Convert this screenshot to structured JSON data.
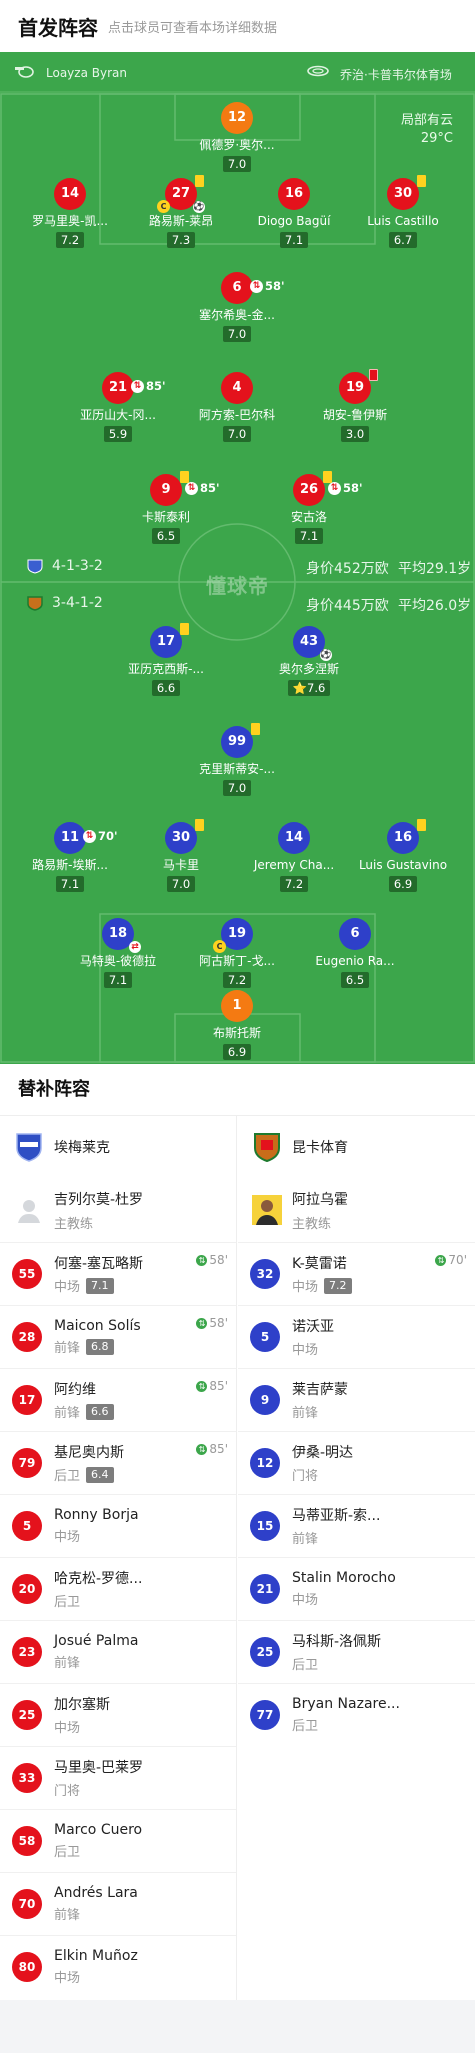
{
  "header": {
    "title": "首发阵容",
    "subtitle": "点击球员可查看本场详细数据"
  },
  "pitch": {
    "home_team": "Loayza Byran",
    "stadium": "乔治·卡普韦尔体育场",
    "weather": "局部有云",
    "temperature": "29°C",
    "home_formation": "4-1-3-2",
    "home_value": "身价452万欧",
    "home_age": "平均29.1岁",
    "away_formation": "3-4-1-2",
    "away_value": "身价445万欧",
    "away_age": "平均26.0岁",
    "watermark": "懂球帝",
    "colors": {
      "pitch": "#3ca64b",
      "home": "#e4121c",
      "away": "#2e40c9",
      "keeper_home": "#f47a12",
      "yellow_card": "#ffd21f"
    }
  },
  "home_players": [
    {
      "num": "12",
      "name": "佩德罗·奥尔...",
      "rating": "7.0"
    },
    {
      "num": "14",
      "name": "罗马里奥-凯...",
      "rating": "7.2"
    },
    {
      "num": "27",
      "name": "路易斯-莱昂",
      "rating": "7.3"
    },
    {
      "num": "16",
      "name": "Diogo Bagüí",
      "rating": "7.1"
    },
    {
      "num": "30",
      "name": "Luis Castillo",
      "rating": "6.7"
    },
    {
      "num": "6",
      "name": "塞尔希奥-金...",
      "rating": "7.0",
      "sub_min": "58'"
    },
    {
      "num": "21",
      "name": "亚历山大-冈...",
      "rating": "5.9",
      "sub_min": "85'"
    },
    {
      "num": "4",
      "name": "阿方索-巴尔科",
      "rating": "7.0"
    },
    {
      "num": "19",
      "name": "胡安-鲁伊斯",
      "rating": "3.0"
    },
    {
      "num": "9",
      "name": "卡斯泰利",
      "rating": "6.5",
      "sub_min": "85'"
    },
    {
      "num": "26",
      "name": "安古洛",
      "rating": "7.1",
      "sub_min": "58'"
    }
  ],
  "away_players": [
    {
      "num": "17",
      "name": "亚历克西斯-...",
      "rating": "6.6"
    },
    {
      "num": "43",
      "name": "奥尔多涅斯",
      "rating": "7.6",
      "star": "⭐"
    },
    {
      "num": "99",
      "name": "克里斯蒂安-...",
      "rating": "7.0"
    },
    {
      "num": "11",
      "name": "路易斯-埃斯...",
      "rating": "7.1",
      "sub_min": "70'"
    },
    {
      "num": "30",
      "name": "马卡里",
      "rating": "7.0"
    },
    {
      "num": "14",
      "name": "Jeremy Cha...",
      "rating": "7.2"
    },
    {
      "num": "16",
      "name": "Luis Gustavino",
      "rating": "6.9"
    },
    {
      "num": "18",
      "name": "马特奥-彼德拉",
      "rating": "7.1"
    },
    {
      "num": "19",
      "name": "阿古斯丁-戈...",
      "rating": "7.2"
    },
    {
      "num": "6",
      "name": "Eugenio Ra...",
      "rating": "6.5"
    },
    {
      "num": "1",
      "name": "布斯托斯",
      "rating": "6.9"
    }
  ],
  "subs": {
    "title": "替补阵容",
    "home": {
      "team": "埃梅莱克",
      "coach": "吉列尔莫-杜罗",
      "coach_role": "主教练",
      "players": [
        {
          "num": "55",
          "name": "何塞-塞瓦略斯",
          "pos": "中场",
          "rating": "7.1",
          "time": "58'"
        },
        {
          "num": "28",
          "name": "Maicon Solís",
          "pos": "前锋",
          "rating": "6.8",
          "time": "58'"
        },
        {
          "num": "17",
          "name": "阿约维",
          "pos": "前锋",
          "rating": "6.6",
          "time": "85'"
        },
        {
          "num": "79",
          "name": "基尼奥内斯",
          "pos": "后卫",
          "rating": "6.4",
          "time": "85'"
        },
        {
          "num": "5",
          "name": "Ronny Borja",
          "pos": "中场"
        },
        {
          "num": "20",
          "name": "哈克松-罗德...",
          "pos": "后卫"
        },
        {
          "num": "23",
          "name": "Josué Palma",
          "pos": "前锋"
        },
        {
          "num": "25",
          "name": "加尔塞斯",
          "pos": "中场"
        },
        {
          "num": "33",
          "name": "马里奥-巴莱罗",
          "pos": "门将"
        },
        {
          "num": "58",
          "name": "Marco Cuero",
          "pos": "后卫"
        },
        {
          "num": "70",
          "name": "Andrés Lara",
          "pos": "前锋"
        },
        {
          "num": "80",
          "name": "Elkin Muñoz",
          "pos": "中场"
        }
      ]
    },
    "away": {
      "team": "昆卡体育",
      "coach": "阿拉乌霍",
      "coach_role": "主教练",
      "players": [
        {
          "num": "32",
          "name": "K-莫雷诺",
          "pos": "中场",
          "rating": "7.2",
          "time": "70'"
        },
        {
          "num": "5",
          "name": "诺沃亚",
          "pos": "中场"
        },
        {
          "num": "9",
          "name": "莱吉萨蒙",
          "pos": "前锋"
        },
        {
          "num": "12",
          "name": "伊桑-明达",
          "pos": "门将"
        },
        {
          "num": "15",
          "name": "马蒂亚斯-索...",
          "pos": "前锋"
        },
        {
          "num": "21",
          "name": "Stalin Morocho",
          "pos": "中场"
        },
        {
          "num": "25",
          "name": "马科斯-洛佩斯",
          "pos": "后卫"
        },
        {
          "num": "77",
          "name": "Bryan Nazare...",
          "pos": "后卫"
        }
      ]
    }
  }
}
